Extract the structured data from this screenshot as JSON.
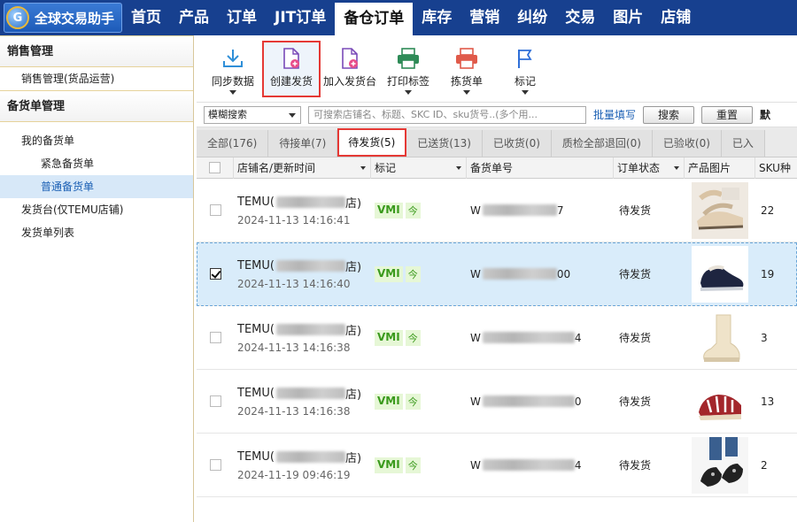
{
  "app": {
    "logo_letter": "G",
    "name": "全球交易助手"
  },
  "nav": {
    "tabs": [
      "首页",
      "产品",
      "订单",
      "JIT订单",
      "备仓订单",
      "库存",
      "营销",
      "纠纷",
      "交易",
      "图片",
      "店铺"
    ],
    "active_index": 4
  },
  "sidebar": {
    "group1": "销售管理",
    "item_sales": "销售管理(货品运营)",
    "group2": "备货单管理",
    "my_orders": "我的备货单",
    "urgent": "紧急备货单",
    "normal": "普通备货单",
    "ship_desk": "发货台(仅TEMU店铺)",
    "ship_list": "发货单列表"
  },
  "toolbar": {
    "sync": "同步数据",
    "create": "创建发货",
    "add_desk": "加入发货台",
    "print": "打印标签",
    "pick": "拣货单",
    "mark": "标记"
  },
  "search": {
    "mode": "模糊搜索",
    "placeholder": "可搜索店铺名、标题、SKC ID、sku货号..(多个用...",
    "batch": "批量填写",
    "search_btn": "搜索",
    "reset_btn": "重置",
    "trail": "默"
  },
  "status_tabs": [
    "全部(176)",
    "待接单(7)",
    "待发货(5)",
    "已送货(13)",
    "已收货(0)",
    "质检全部退回(0)",
    "已验收(0)",
    "已入"
  ],
  "status_active": 2,
  "columns": {
    "store": "店铺名/更新时间",
    "mark": "标记",
    "order_no": "备货单号",
    "status": "订单状态",
    "image": "产品图片",
    "sku": "SKU种"
  },
  "rows": [
    {
      "store": "TEMU(",
      "store_tail": "店)",
      "time": "2024-11-13 14:16:41",
      "vmi": "VMI",
      "jin": "今",
      "no_prefix": "W",
      "no_suffix": "7",
      "status": "待发货",
      "sku": "22",
      "checked": false
    },
    {
      "store": "TEMU(",
      "store_tail": "店)",
      "time": "2024-11-13 14:16:40",
      "vmi": "VMI",
      "jin": "今",
      "no_prefix": "W",
      "no_suffix": "00",
      "status": "待发货",
      "sku": "19",
      "checked": true
    },
    {
      "store": "TEMU(",
      "store_tail": "店)",
      "time": "2024-11-13 14:16:38",
      "vmi": "VMI",
      "jin": "今",
      "no_prefix": "W",
      "no_suffix": "4",
      "status": "待发货",
      "sku": "3",
      "checked": false
    },
    {
      "store": "TEMU(",
      "store_tail": "店)",
      "time": "2024-11-13 14:16:38",
      "vmi": "VMI",
      "jin": "今",
      "no_prefix": "W",
      "no_suffix": "0",
      "status": "待发货",
      "sku": "13",
      "checked": false
    },
    {
      "store": "TEMU(",
      "store_tail": "店)",
      "time": "2024-11-19 09:46:19",
      "vmi": "VMI",
      "jin": "今",
      "no_prefix": "W",
      "no_suffix": "4",
      "status": "待发货",
      "sku": "2",
      "checked": false
    }
  ],
  "colors": {
    "nav_bg": "#17408f",
    "highlight_red": "#e53935",
    "vmi_green": "#3a9a1c",
    "selected_row": "#d9ecfa"
  },
  "icons": [
    "download-icon",
    "document-plus-icon",
    "document-add-icon",
    "printer-icon",
    "printer-red-icon",
    "flag-icon"
  ]
}
